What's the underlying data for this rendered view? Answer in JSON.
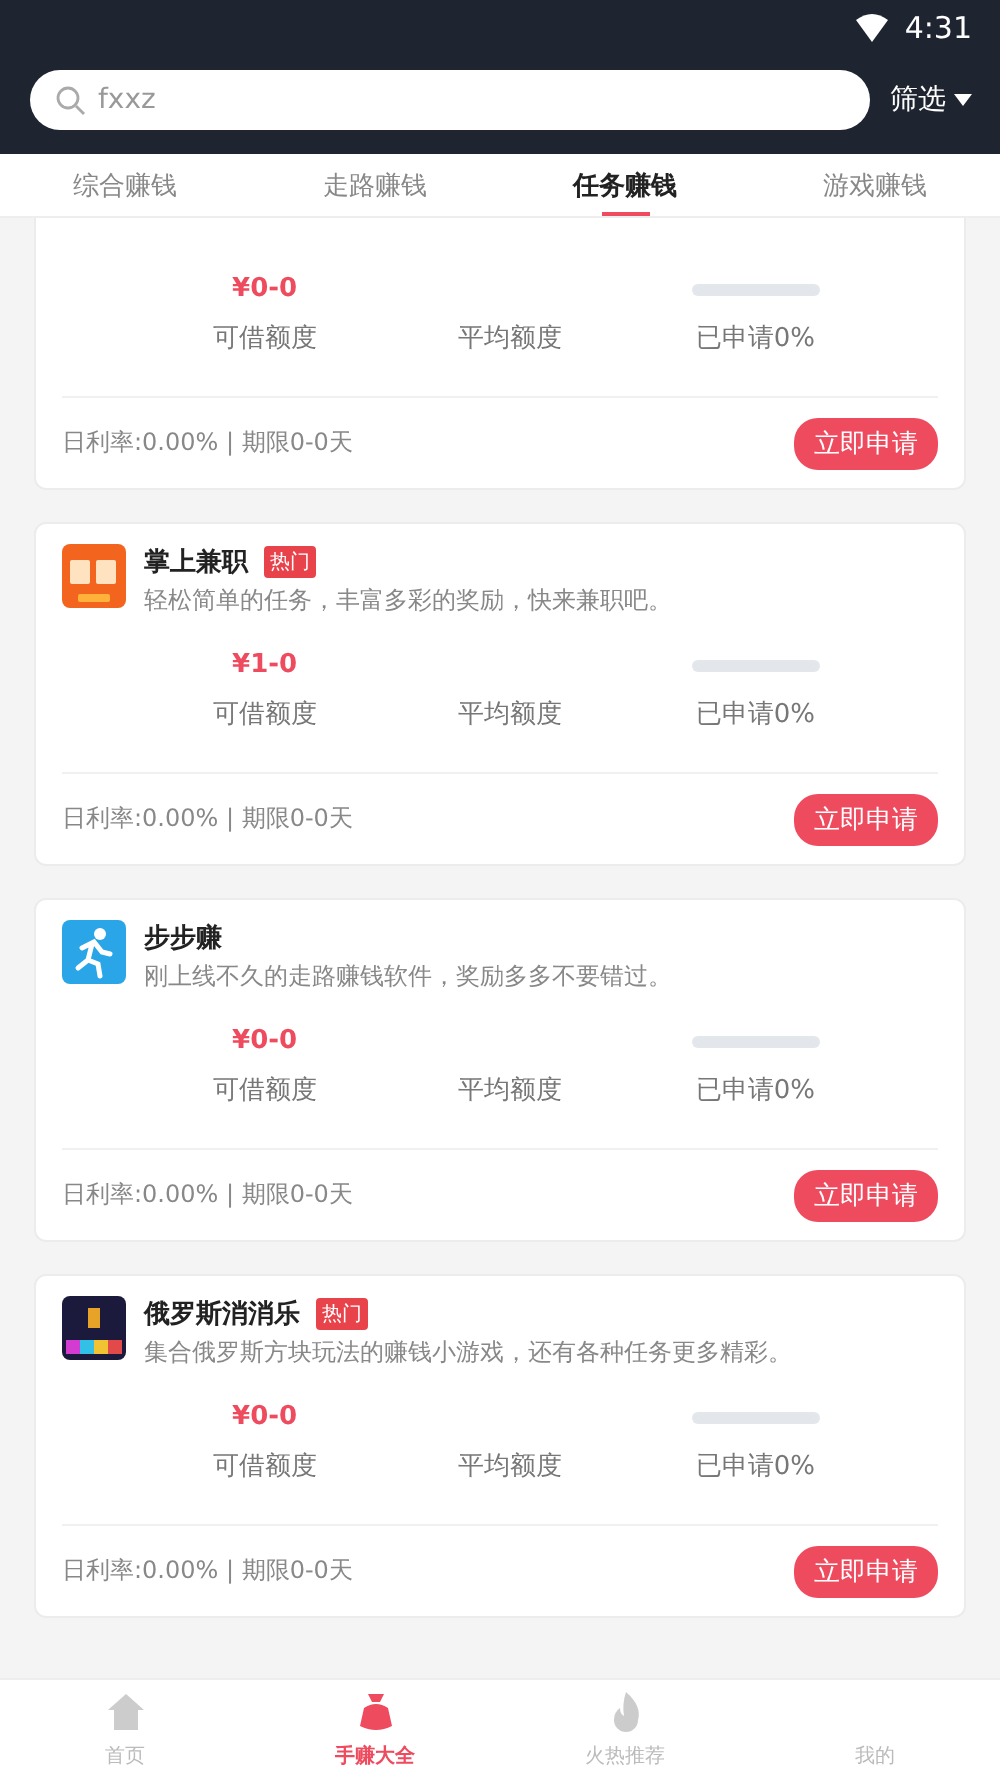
{
  "status_bar": {
    "time": "4:31"
  },
  "search": {
    "value": "fxxz",
    "filter_label": "筛选"
  },
  "tabs": [
    {
      "label": "综合赚钱",
      "selected": false
    },
    {
      "label": "走路赚钱",
      "selected": false
    },
    {
      "label": "任务赚钱",
      "selected": true
    },
    {
      "label": "游戏赚钱",
      "selected": false
    }
  ],
  "cards": [
    {
      "amount": "¥0-0",
      "credit_label": "可借额度",
      "average_label": "平均额度",
      "applied": "已申请0%",
      "level": 0,
      "terms": "日利率:0.00% | 期限0-0天",
      "button": "立即申请"
    },
    {
      "name": "掌上兼职",
      "badge": "热门",
      "description": "轻松简单的任务，丰富多彩的奖励，快来兼职吧。",
      "amount": "¥1-0",
      "credit_label": "可借额度",
      "average_label": "平均额度",
      "applied": "已申请0%",
      "level": 0,
      "terms": "日利率:0.00% | 期限0-0天",
      "button": "立即申请"
    },
    {
      "name": "步步赚",
      "description": "刚上线不久的走路赚钱软件，奖励多多不要错过。",
      "amount": "¥0-0",
      "credit_label": "可借额度",
      "average_label": "平均额度",
      "applied": "已申请0%",
      "level": 0,
      "terms": "日利率:0.00% | 期限0-0天",
      "button": "立即申请"
    },
    {
      "name": "俄罗斯消消乐",
      "badge": "热门",
      "description": "集合俄罗斯方块玩法的赚钱小游戏，还有各种任务更多精彩。",
      "amount": "¥0-0",
      "credit_label": "可借额度",
      "average_label": "平均额度",
      "applied": "已申请0%",
      "level": 0,
      "terms": "日利率:0.00% | 期限0-0天",
      "button": "立即申请"
    }
  ],
  "bottom_nav": [
    {
      "label": "首页",
      "selected": false
    },
    {
      "label": "手赚大全",
      "selected": true
    },
    {
      "label": "火热推荐",
      "selected": false
    },
    {
      "label": "我的",
      "selected": false
    }
  ]
}
